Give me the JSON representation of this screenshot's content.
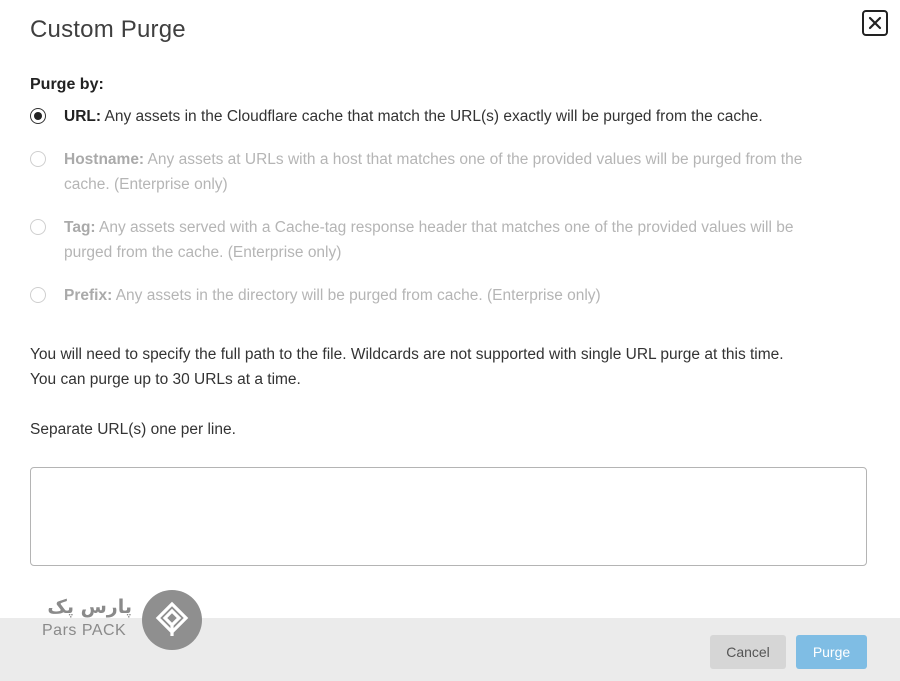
{
  "dialog": {
    "title": "Custom Purge",
    "close_icon": "close-icon"
  },
  "purge_by": {
    "label": "Purge by:",
    "options": [
      {
        "name": "URL:",
        "description": " Any assets in the Cloudflare cache that match the URL(s) exactly will be purged from the cache.",
        "selected": true,
        "enabled": true
      },
      {
        "name": "Hostname:",
        "description": " Any assets at URLs with a host that matches one of the provided values will be purged from the cache. (Enterprise only)",
        "selected": false,
        "enabled": false
      },
      {
        "name": "Tag:",
        "description": " Any assets served with a Cache-tag response header that matches one of the provided values will be purged from the cache. (Enterprise only)",
        "selected": false,
        "enabled": false
      },
      {
        "name": "Prefix:",
        "description": " Any assets in the directory will be purged from cache. (Enterprise only)",
        "selected": false,
        "enabled": false
      }
    ]
  },
  "info_text": "You will need to specify the full path to the file. Wildcards are not supported with single URL purge at this time. You can purge up to 30 URLs at a time.",
  "separate_label": "Separate URL(s) one per line.",
  "url_input": {
    "value": "",
    "placeholder": ""
  },
  "footer": {
    "cancel_label": "Cancel",
    "purge_label": "Purge"
  },
  "watermark": {
    "text_fa": "پارس پک",
    "text_en": "Pars PACK"
  },
  "colors": {
    "purge_button": "#7fbde4",
    "cancel_button": "#d6d6d6",
    "footer_bg": "#ebebeb",
    "disabled_text": "#b5b5b5"
  }
}
